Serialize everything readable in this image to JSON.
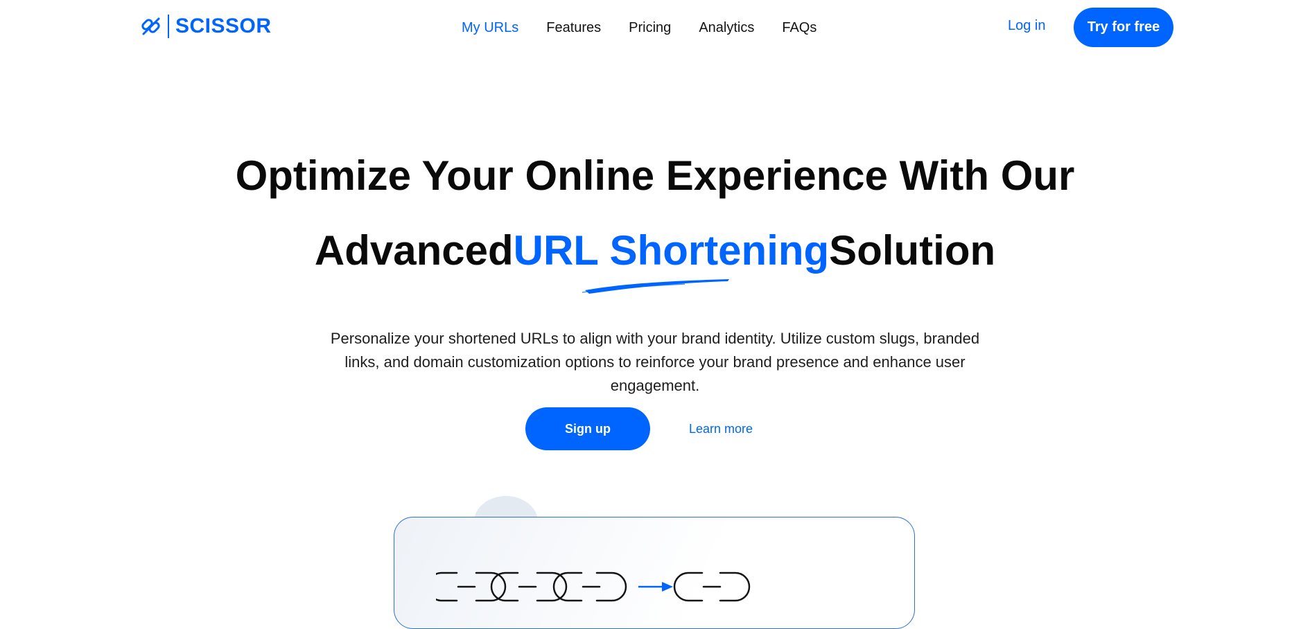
{
  "brand": {
    "name": "SCISSOR",
    "color": "#0065fe",
    "icon": "scissor-link-icon"
  },
  "nav": [
    {
      "label": "My URLs",
      "active": true
    },
    {
      "label": "Features",
      "active": false
    },
    {
      "label": "Pricing",
      "active": false
    },
    {
      "label": "Analytics",
      "active": false
    },
    {
      "label": "FAQs",
      "active": false
    }
  ],
  "auth": {
    "login_label": "Log in",
    "cta_label": "Try for free"
  },
  "hero": {
    "line1": "Optimize Your Online Experience With Our",
    "line2_before": "Advanced",
    "line2_highlight": "URL Shortening",
    "line2_after": "Solution",
    "description": "Personalize your shortened URLs to align with your brand identity. Utilize custom slugs, branded links, and domain customization options to reinforce your brand presence and enhance user engagement.",
    "signup_label": "Sign up",
    "learn_label": "Learn more"
  },
  "illustration": {
    "long_chain_links": 3,
    "short_chain_links": 1,
    "arrow": "arrow-right-icon"
  },
  "colors": {
    "accent": "#0065fe",
    "text": "#141414",
    "card_border": "#2f6fd0"
  }
}
